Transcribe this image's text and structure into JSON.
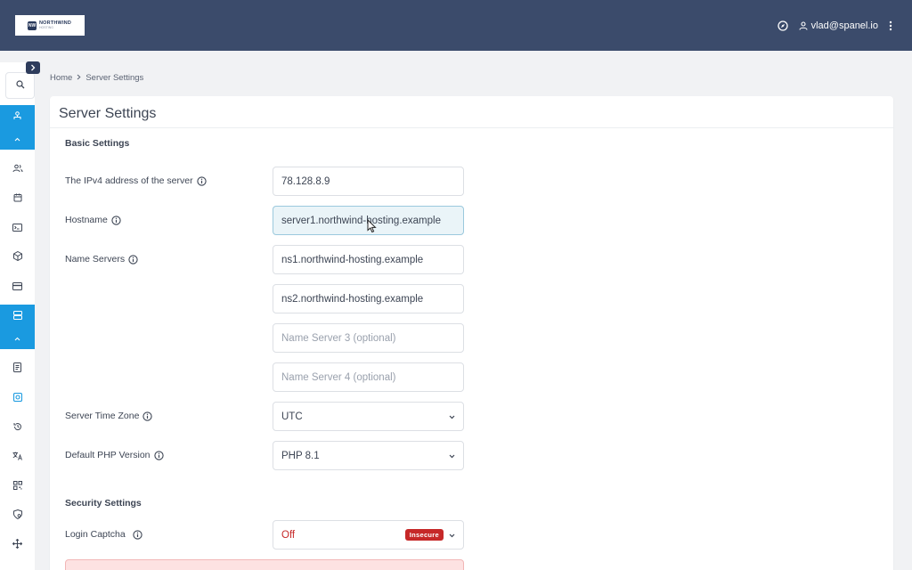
{
  "header": {
    "logo_name": "NORTHWIND",
    "logo_sub": "HOSTING",
    "logo_mark": "NW",
    "user_email": "vlad@spanel.io",
    "icons": [
      "compass-icon",
      "user-icon",
      "kebab-menu-icon"
    ]
  },
  "sidebar": {
    "icons": [
      "search-icon",
      "server-network-icon",
      "users-icon",
      "calendar-icon",
      "terminal-icon",
      "package-icon",
      "card-icon",
      "database-server-icon",
      "document-icon",
      "settings-icon",
      "history-icon",
      "translate-icon",
      "qr-icon",
      "shield-icon",
      "move-icon"
    ]
  },
  "breadcrumb": {
    "home": "Home",
    "current": "Server Settings"
  },
  "page": {
    "title": "Server Settings",
    "basic_section": "Basic Settings",
    "security_section": "Security Settings"
  },
  "fields": {
    "ipv4_label": "The IPv4 address of the server",
    "ipv4_value": "78.128.8.9",
    "hostname_label": "Hostname",
    "hostname_value": "server1.northwind-hosting.example",
    "nameservers_label": "Name Servers",
    "ns1_value": "ns1.northwind-hosting.example",
    "ns2_value": "ns2.northwind-hosting.example",
    "ns3_placeholder": "Name Server 3 (optional)",
    "ns4_placeholder": "Name Server 4 (optional)",
    "timezone_label": "Server Time Zone",
    "timezone_value": "UTC",
    "php_label": "Default PHP Version",
    "php_value": "PHP 8.1",
    "captcha_label": "Login Captcha",
    "captcha_value": "Off",
    "captcha_badge": "Insecure"
  },
  "colors": {
    "topbar": "#3b4b6b",
    "accent": "#1a9ae0",
    "danger": "#c62828"
  }
}
